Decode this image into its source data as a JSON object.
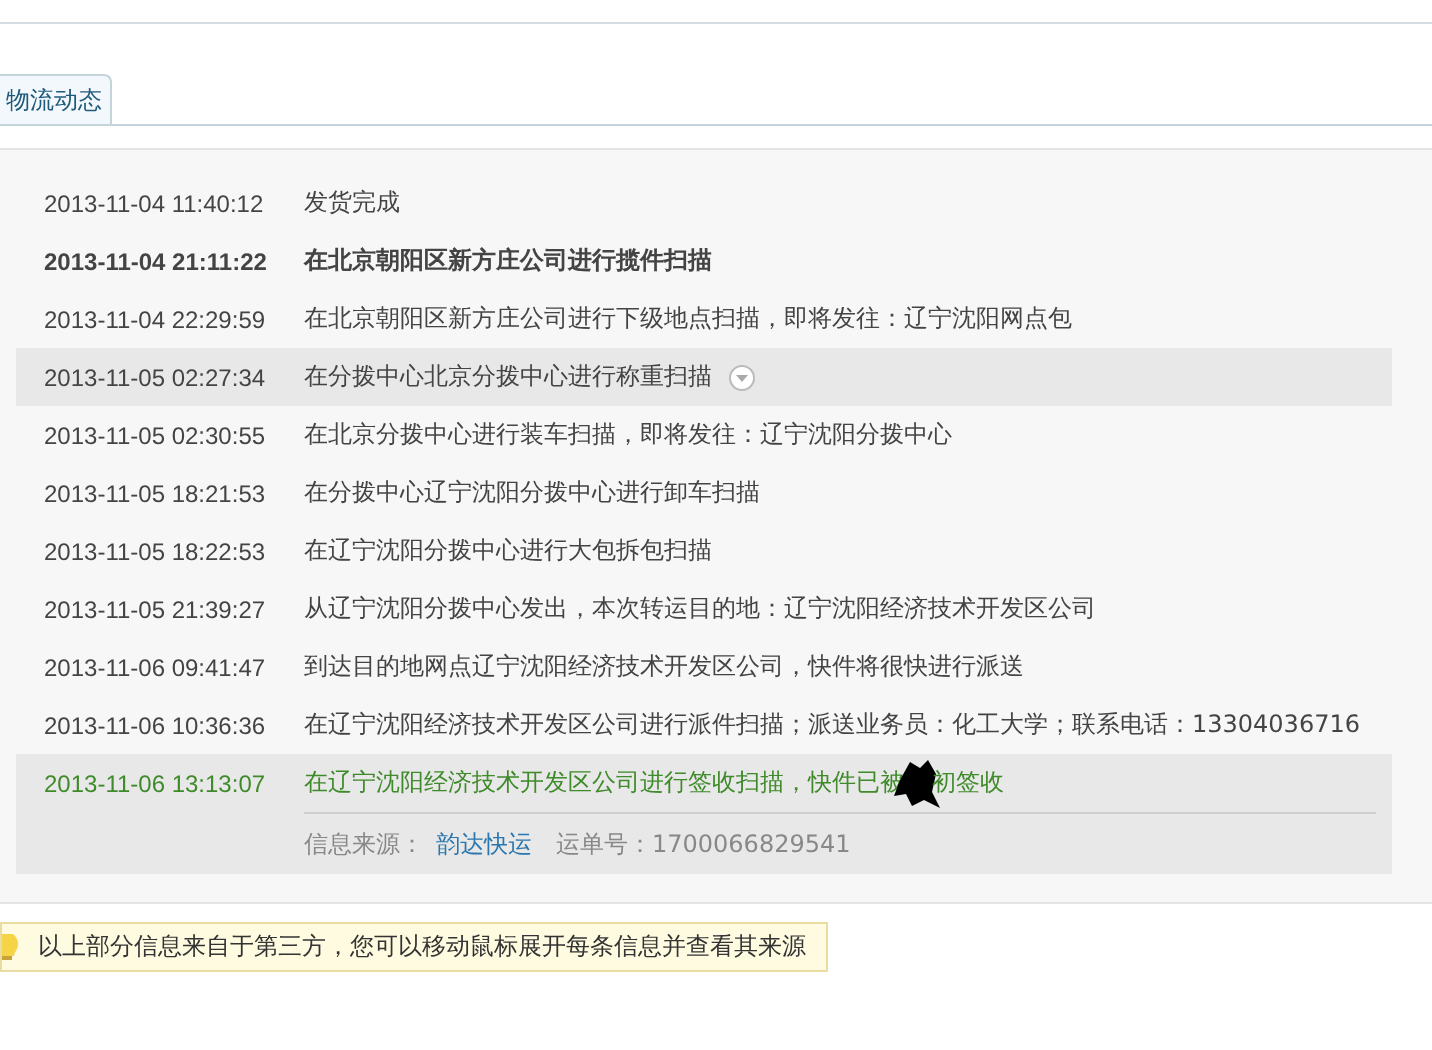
{
  "tabs": [
    {
      "label": "物流动态",
      "selected": true
    }
  ],
  "events": [
    {
      "time": "2013-11-04 11:40:12",
      "text": "发货完成",
      "bold": false,
      "highlighted": false,
      "latest": false
    },
    {
      "time": "2013-11-04 21:11:22",
      "text": "在北京朝阳区新方庄公司进行揽件扫描",
      "bold": true,
      "highlighted": false,
      "latest": false
    },
    {
      "time": "2013-11-04 22:29:59",
      "text": "在北京朝阳区新方庄公司进行下级地点扫描，即将发往：辽宁沈阳网点包",
      "bold": false,
      "highlighted": false,
      "latest": false
    },
    {
      "time": "2013-11-05 02:27:34",
      "text": "在分拨中心北京分拨中心进行称重扫描",
      "bold": false,
      "highlighted": true,
      "latest": false
    },
    {
      "time": "2013-11-05 02:30:55",
      "text": "在北京分拨中心进行装车扫描，即将发往：辽宁沈阳分拨中心",
      "bold": false,
      "highlighted": false,
      "latest": false
    },
    {
      "time": "2013-11-05 18:21:53",
      "text": "在分拨中心辽宁沈阳分拨中心进行卸车扫描",
      "bold": false,
      "highlighted": false,
      "latest": false
    },
    {
      "time": "2013-11-05 18:22:53",
      "text": "在辽宁沈阳分拨中心进行大包拆包扫描",
      "bold": false,
      "highlighted": false,
      "latest": false
    },
    {
      "time": "2013-11-05 21:39:27",
      "text": "从辽宁沈阳分拨中心发出，本次转运目的地：辽宁沈阳经济技术开发区公司",
      "bold": false,
      "highlighted": false,
      "latest": false
    },
    {
      "time": "2013-11-06 09:41:47",
      "text": "到达目的地网点辽宁沈阳经济技术开发区公司，快件将很快进行派送",
      "bold": false,
      "highlighted": false,
      "latest": false
    },
    {
      "time": "2013-11-06 10:36:36",
      "text": "在辽宁沈阳经济技术开发区公司进行派件扫描；派送业务员：化工大学；联系电话：13304036716",
      "bold": false,
      "highlighted": false,
      "latest": false
    },
    {
      "time": "2013-11-06 13:13:07",
      "text": "在辽宁沈阳经济技术开发区公司进行签收扫描，快件已被",
      "text_after_redaction": "初签收",
      "bold": false,
      "highlighted": true,
      "latest": true
    }
  ],
  "source": {
    "label": "信息来源：",
    "carrier": "韵达快运",
    "waybill_label": "运单号：",
    "waybill": "1700066829541"
  },
  "notice": "以上部分信息来自于第三方，您可以移动鼠标展开每条信息并查看其来源"
}
